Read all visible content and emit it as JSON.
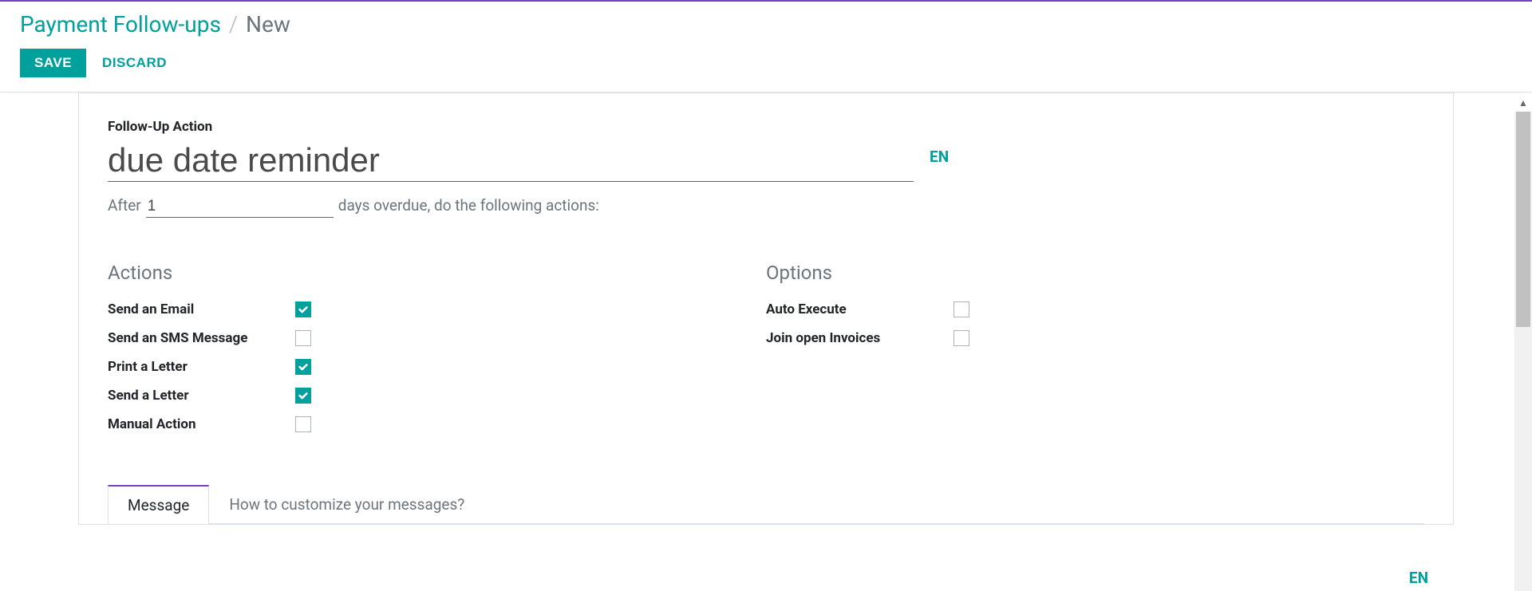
{
  "breadcrumb": {
    "parent": "Payment Follow-ups",
    "separator": "/",
    "current": "New"
  },
  "header": {
    "save_label": "SAVE",
    "discard_label": "DISCARD"
  },
  "form": {
    "action_label": "Follow-Up Action",
    "title_value": "due date reminder",
    "lang": "EN",
    "after_text": "After",
    "days_value": "1",
    "days_suffix": "days overdue, do the following actions:"
  },
  "actions": {
    "title": "Actions",
    "items": [
      {
        "label": "Send an Email",
        "checked": true
      },
      {
        "label": "Send an SMS Message",
        "checked": false
      },
      {
        "label": "Print a Letter",
        "checked": true
      },
      {
        "label": "Send a Letter",
        "checked": true
      },
      {
        "label": "Manual Action",
        "checked": false
      }
    ]
  },
  "options": {
    "title": "Options",
    "items": [
      {
        "label": "Auto Execute",
        "checked": false
      },
      {
        "label": "Join open Invoices",
        "checked": false
      }
    ]
  },
  "tabs": [
    {
      "label": "Message",
      "active": true
    },
    {
      "label": "How to customize your messages?",
      "active": false
    }
  ],
  "bottom_lang": "EN"
}
